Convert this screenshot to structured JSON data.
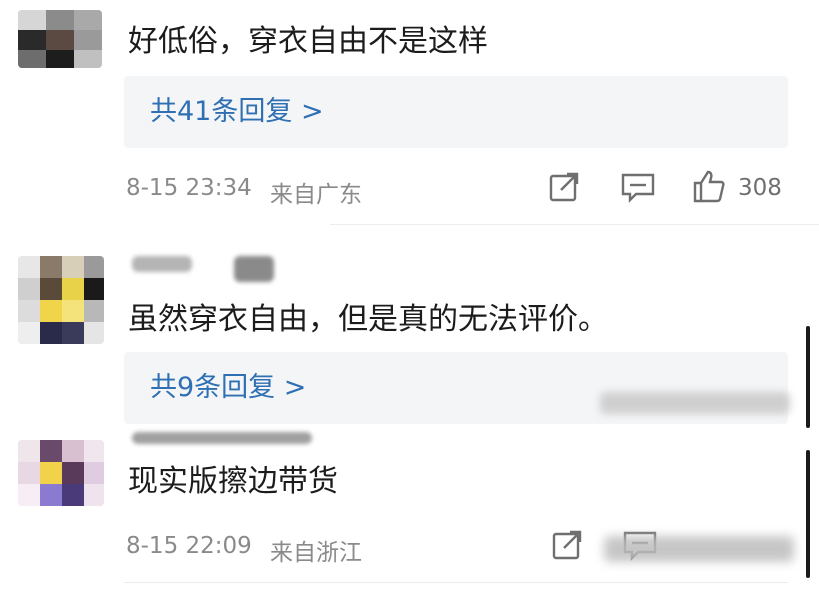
{
  "comments": [
    {
      "text": "好低俗，穿衣自由不是这样",
      "replies": "共41条回复 >",
      "time": "8-15 23:34",
      "location": "来自广东",
      "likes": "308"
    },
    {
      "text": "虽然穿衣自由，但是真的无法评价。",
      "replies": "共9条回复 >"
    },
    {
      "text": "现实版擦边带货",
      "time": "8-15 22:09",
      "location": "来自浙江"
    }
  ],
  "icons": [
    "share-icon",
    "comment-icon",
    "like-icon"
  ]
}
